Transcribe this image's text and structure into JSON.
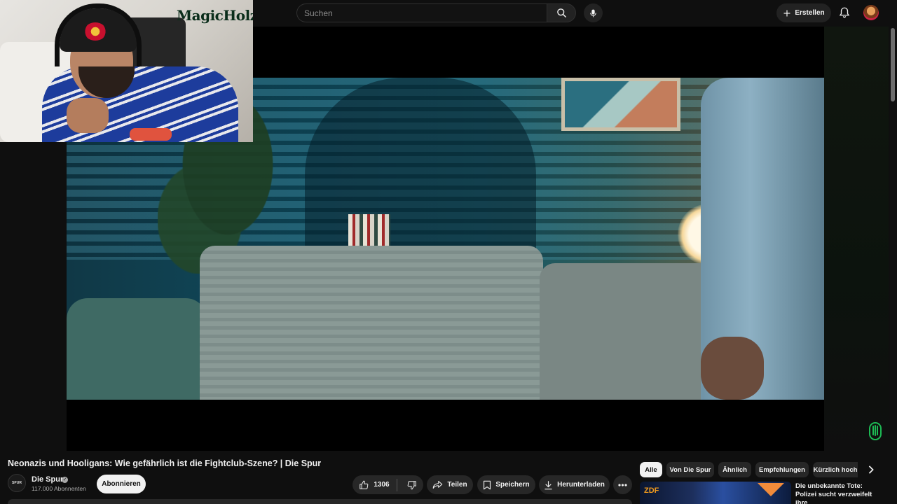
{
  "search": {
    "placeholder": "Suchen"
  },
  "header": {
    "create_label": "Erstellen"
  },
  "overlay": {
    "brand_logo": "MagicHolz"
  },
  "video": {
    "title": "Neonazis und Hooligans: Wie gefährlich ist die Fightclub-Szene? | Die Spur"
  },
  "channel": {
    "name": "Die Spur",
    "avatar_text": "SPUR",
    "subscribers": "117.000 Abonnenten",
    "subscribe_label": "Abonnieren"
  },
  "actions": {
    "like_count": "1306",
    "share_label": "Teilen",
    "save_label": "Speichern",
    "download_label": "Herunterladen"
  },
  "chips": [
    "Alle",
    "Von Die Spur",
    "Ähnlich",
    "Empfehlungen",
    "Kürzlich hoch"
  ],
  "recommendation": {
    "badge": "ZDF",
    "title": "Die unbekannte Tote: Polizei sucht verzweifelt ihre"
  },
  "colors": {
    "background": "#0f0f0f",
    "pill": "#272727",
    "text": "#f1f1f1",
    "muted": "#aaaaaa",
    "extension_accent": "#1db954"
  },
  "icons": [
    "search-icon",
    "mic-icon",
    "plus-icon",
    "bell-icon",
    "thumbs-up-icon",
    "thumbs-down-icon",
    "share-icon",
    "save-icon",
    "download-icon",
    "more-icon",
    "chevron-right-icon",
    "verified-icon",
    "extension-icon"
  ]
}
